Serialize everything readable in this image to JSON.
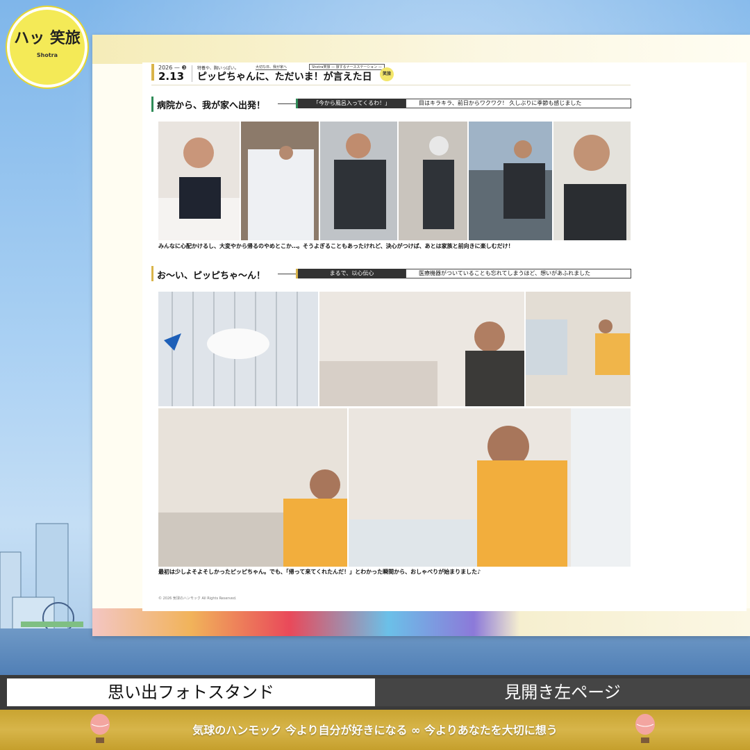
{
  "logo": {
    "text": "笑旅",
    "sub": "Shotra",
    "mark": "ハッ"
  },
  "header": {
    "year": "2026 — ❸",
    "date": "2.13",
    "kicker": "特養や、胸いっぱい。",
    "title": "ピッピちゃんに、ただいま！が言えた日",
    "tag1": "大切な日、我が家へ",
    "tag2": "Shotra笑旅 — 旅するナースステーション —",
    "badge": "笑旅"
  },
  "section1": {
    "title": "病院から、我が家へ出発！",
    "pill": "「今から風呂入ってくるわ！」",
    "desc": "目はキラキラ、前日からワクワク！ 久しぶりに季節も感じました",
    "caption": "みんなに心配かけるし、大変やから帰るのやめとこか…。そうよぎることもあったけれど、決心がつけば、あとは家族と前向きに楽しむだけ！"
  },
  "section2": {
    "title": "お〜い、ピッピちゃ〜ん！",
    "pill": "まるで、以心伝心",
    "desc": "医療機器がついていることも忘れてしまうほど、想いがあふれました",
    "caption": "最初は少しよそよそしかったピッピちゃん。でも、「帰って来てくれたんだ！」とわかった瞬間から、おしゃべりが始まりました♪"
  },
  "copyright": "© 2026 気球のハンモック All Rights Reserved.",
  "nav": {
    "left": "思い出フォトスタンド",
    "right": "見開き左ページ"
  },
  "footer": {
    "text": "気球のハンモック 今より自分が好きになる ∞ 今よりあなたを大切に想う"
  },
  "colors": {
    "accent_green": "#2e8b57",
    "accent_gold": "#d9b44a",
    "footer_gold": "#c9a431",
    "nav_dark": "#454545"
  }
}
